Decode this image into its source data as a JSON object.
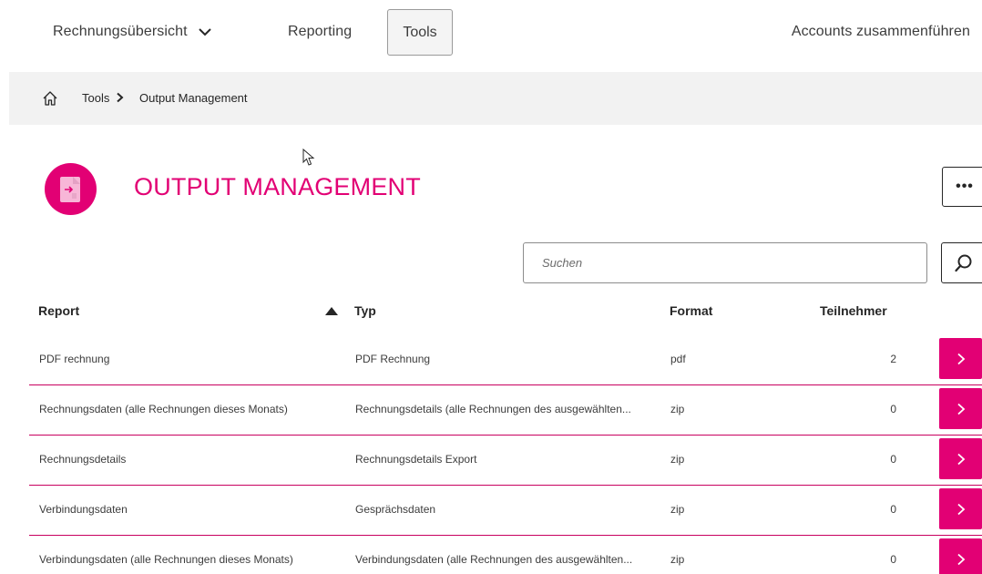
{
  "nav": {
    "billing_label": "Rechnungsübersicht",
    "reporting_label": "Reporting",
    "tools_label": "Tools",
    "merge_label": "Accounts zusammenführen"
  },
  "breadcrumb": {
    "home_icon": "home-icon",
    "tools_label": "Tools",
    "current_label": "Output Management"
  },
  "page": {
    "title": "OUTPUT MANAGEMENT",
    "more_label": "•••",
    "icon": "document-export-icon"
  },
  "search": {
    "placeholder": "Suchen",
    "value": ""
  },
  "table": {
    "headers": {
      "report": "Report",
      "typ": "Typ",
      "format": "Format",
      "teilnehmer": "Teilnehmer"
    },
    "sort": "ascending",
    "rows": [
      {
        "report": "PDF rechnung",
        "typ": "PDF Rechnung",
        "format": "pdf",
        "teilnehmer": "2"
      },
      {
        "report": "Rechnungsdaten (alle Rechnungen dieses Monats)",
        "typ": "Rechnungsdetails (alle Rechnungen des ausgewählten...",
        "format": "zip",
        "teilnehmer": "0"
      },
      {
        "report": "Rechnungsdetails",
        "typ": "Rechnungsdetails Export",
        "format": "zip",
        "teilnehmer": "0"
      },
      {
        "report": "Verbindungsdaten",
        "typ": "Gesprächsdaten",
        "format": "zip",
        "teilnehmer": "0"
      },
      {
        "report": "Verbindungsdaten (alle Rechnungen dieses Monats)",
        "typ": "Verbindungsdaten (alle Rechnungen des ausgewählten...",
        "format": "zip",
        "teilnehmer": "0"
      }
    ]
  },
  "colors": {
    "brand": "#e20074",
    "divider": "#c8005f",
    "breadcrumb_bg": "#f2f2f2"
  }
}
